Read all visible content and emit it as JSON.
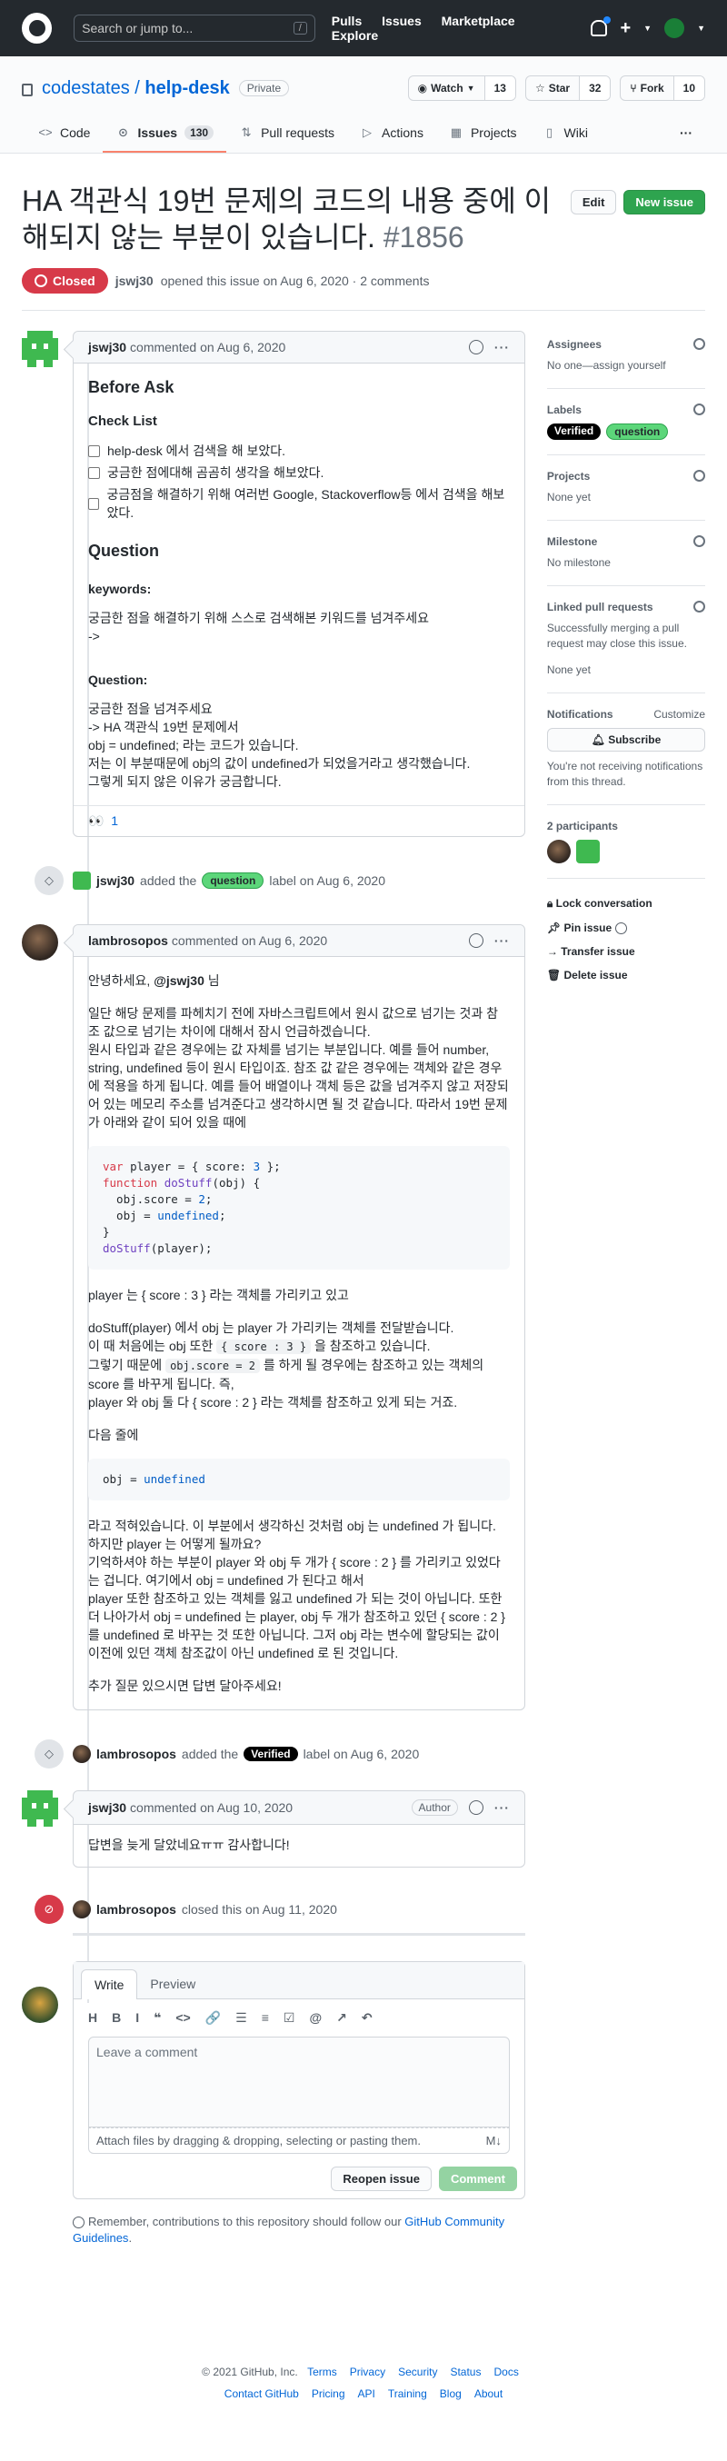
{
  "header": {
    "search_placeholder": "Search or jump to...",
    "search_key": "/",
    "nav": [
      "Pulls",
      "Issues",
      "Marketplace",
      "Explore"
    ]
  },
  "repo": {
    "owner": "codestates",
    "name": "help-desk",
    "visibility": "Private",
    "watch_label": "Watch",
    "watch_count": "13",
    "star_label": "Star",
    "star_count": "32",
    "fork_label": "Fork",
    "fork_count": "10",
    "tabs": [
      {
        "label": "Code",
        "icon": "code-icon"
      },
      {
        "label": "Issues",
        "count": "130",
        "icon": "issue-icon"
      },
      {
        "label": "Pull requests",
        "icon": "pr-icon"
      },
      {
        "label": "Actions",
        "icon": "play-icon"
      },
      {
        "label": "Projects",
        "icon": "project-icon"
      },
      {
        "label": "Wiki",
        "icon": "book-icon"
      }
    ],
    "more": "···"
  },
  "issue": {
    "title": "HA 객관식 19번 문제의 코드의 내용 중에 이해되지 않는 부분이 있습니다.",
    "number": "#1856",
    "edit_label": "Edit",
    "new_issue_label": "New issue",
    "state": "Closed",
    "opener": "jswj30",
    "opened_text": "opened this issue on Aug 6, 2020 · 2 comments"
  },
  "comments": {
    "first": {
      "author": "jswj30",
      "date": "commented on Aug 6, 2020",
      "h_before": "Before Ask",
      "h_check": "Check List",
      "checks": [
        "help-desk 에서 검색을 해 보았다.",
        "궁금한 점에대해 곰곰히 생각을 해보았다.",
        "궁금점을 해결하기 위해 여러번 Google, Stackoverflow등 에서 검색을 해보았다."
      ],
      "h_question": "Question",
      "keywords_label": "keywords:",
      "keywords_text1": "궁금한 점을 해결하기 위해 스스로 검색해본 키워드를 넘겨주세요",
      "keywords_text2": "->",
      "question_label": "Question:",
      "q_lines": [
        "궁금한 점을 넘겨주세요",
        "-> HA 객관식 19번 문제에서",
        "obj = undefined; 라는 코드가 있습니다.",
        "저는 이 부분때문에 obj의 값이 undefined가 되었을거라고 생각했습니다.",
        "그렇게 되지 않은 이유가 궁금합니다."
      ],
      "reaction_emoji": "👀",
      "reaction_count": "1"
    },
    "event1": {
      "user": "jswj30",
      "pre": "added the",
      "label": "question",
      "post": "label on Aug 6, 2020"
    },
    "second": {
      "author": "lambrosopos",
      "date": "commented on Aug 6, 2020",
      "greeting_pre": "안녕하세요, ",
      "mention": "@jswj30",
      "greeting_post": " 님",
      "p1": "일단 해당 문제를 파헤치기 전에 자바스크립트에서 원시 값으로 넘기는 것과 참조 값으로 넘기는 차이에 대해서 잠시 언급하겠습니다.",
      "p2": "원시 타입과 같은 경우에는 값 자체를 넘기는 부분입니다. 예를 들어 number, string, undefined 등이 원시 타입이죠. 참조 값 같은 경우에는 객체와 같은 경우에 적용을 하게 됩니다. 예를 들어 배열이나 객체 등은 값을 넘겨주지 않고 저장되어 있는 메모리 주소를 넘겨준다고 생각하시면 될 것 같습니다. 따라서 19번 문제가 아래와 같이 되어 있을 때에",
      "p3": "player 는 { score : 3 } 라는 객체를 가리키고 있고",
      "p4a": "doStuff(player) 에서 obj 는 player 가 가리키는 객체를 전달받습니다.",
      "p4b_pre": "이 때 처음에는 obj 또한 ",
      "p4b_code": "{ score : 3 }",
      "p4b_post": " 을 참조하고 있습니다.",
      "p4c_pre": "그렇기 때문에 ",
      "p4c_code": "obj.score = 2",
      "p4c_post": " 를 하게 될 경우에는 참조하고 있는 객체의 score 를 바꾸게 됩니다. 즉,",
      "p4d": "player 와 obj 둘 다 { score : 2 } 라는 객체를 참조하고 있게 되는 거죠.",
      "p5": "다음 줄에",
      "p6a": "라고 적혀있습니다. 이 부분에서 생각하신 것처럼 obj 는 undefined 가 됩니다. 하지만 player 는 어떻게 될까요?",
      "p6b": "기억하셔야 하는 부분이 player 와 obj 두 개가 { score : 2 } 를 가리키고 있었다는 겁니다. 여기에서 obj = undefined 가 된다고 해서",
      "p6c": "player 또한 참조하고 있는 객체를 잃고 undefined 가 되는 것이 아닙니다. 또한 더 나아가서 obj = undefined 는 player, obj 두 개가 참조하고 있던 { score : 2 } 를 undefined 로 바꾸는 것 또한 아닙니다. 그저 obj 라는 변수에 할당되는 값이 이전에 있던 객체 참조값이 아닌 undefined 로 된 것입니다.",
      "p7": "추가 질문 있으시면 답변 달아주세요!"
    },
    "code1": [
      [
        [
          "kw",
          "var"
        ],
        [
          "t",
          " player = { score: "
        ],
        [
          "nm",
          "3"
        ],
        [
          "t",
          " };"
        ]
      ],
      [
        [
          "kw",
          "function"
        ],
        [
          "t",
          " "
        ],
        [
          "fn",
          "doStuff"
        ],
        [
          "t",
          "(obj) {"
        ]
      ],
      [
        [
          "t",
          "  obj.score = "
        ],
        [
          "nm",
          "2"
        ],
        [
          "t",
          ";"
        ]
      ],
      [
        [
          "t",
          "  obj = "
        ],
        [
          "nm",
          "undefined"
        ],
        [
          "t",
          ";"
        ]
      ],
      [
        [
          "t",
          "}"
        ]
      ],
      [
        [
          "fn",
          "doStuff"
        ],
        [
          "t",
          "(player);"
        ]
      ]
    ],
    "code2": [
      [
        [
          "t",
          "obj = "
        ],
        [
          "nm",
          "undefined"
        ]
      ]
    ],
    "event2": {
      "user": "lambrosopos",
      "pre": "added the",
      "label": "Verified",
      "post": "label on Aug 6, 2020"
    },
    "third": {
      "author": "jswj30",
      "date": "commented on Aug 10, 2020",
      "badge": "Author",
      "text": "답변을 늦게 달았네요ㅠㅠ 감사합니다!"
    },
    "event3": {
      "user": "lambrosopos",
      "text": "closed this on Aug 11, 2020"
    }
  },
  "new_comment": {
    "tab_write": "Write",
    "tab_preview": "Preview",
    "toolbar": [
      "H",
      "B",
      "I",
      "❝",
      "<>",
      "🔗",
      "☰",
      "≡",
      "☑",
      "@",
      "↗",
      "↶"
    ],
    "placeholder": "Leave a comment",
    "attach_text": "Attach files by dragging & dropping, selecting or pasting them.",
    "md_icon": "M↓",
    "reopen_label": "Reopen issue",
    "comment_label": "Comment",
    "remember_pre": "Remember, contributions to this repository should follow our ",
    "remember_link": "GitHub Community Guidelines",
    "remember_post": "."
  },
  "sidebar": {
    "assignees_h": "Assignees",
    "assignees_v": "No one—assign yourself",
    "labels_h": "Labels",
    "labels": [
      "Verified",
      "question"
    ],
    "projects_h": "Projects",
    "projects_v": "None yet",
    "milestone_h": "Milestone",
    "milestone_v": "No milestone",
    "linked_h": "Linked pull requests",
    "linked_v1": "Successfully merging a pull request may close this issue.",
    "linked_v2": "None yet",
    "notif_h": "Notifications",
    "notif_customize": "Customize",
    "subscribe": "Subscribe",
    "notif_v": "You're not receiving notifications from this thread.",
    "participants_h": "2 participants",
    "actions": [
      "Lock conversation",
      "Pin issue",
      "Transfer issue",
      "Delete issue"
    ]
  },
  "footer": {
    "copyright": "© 2021 GitHub, Inc.",
    "row1": [
      "Terms",
      "Privacy",
      "Security",
      "Status",
      "Docs"
    ],
    "row2": [
      "Contact GitHub",
      "Pricing",
      "API",
      "Training",
      "Blog",
      "About"
    ]
  }
}
